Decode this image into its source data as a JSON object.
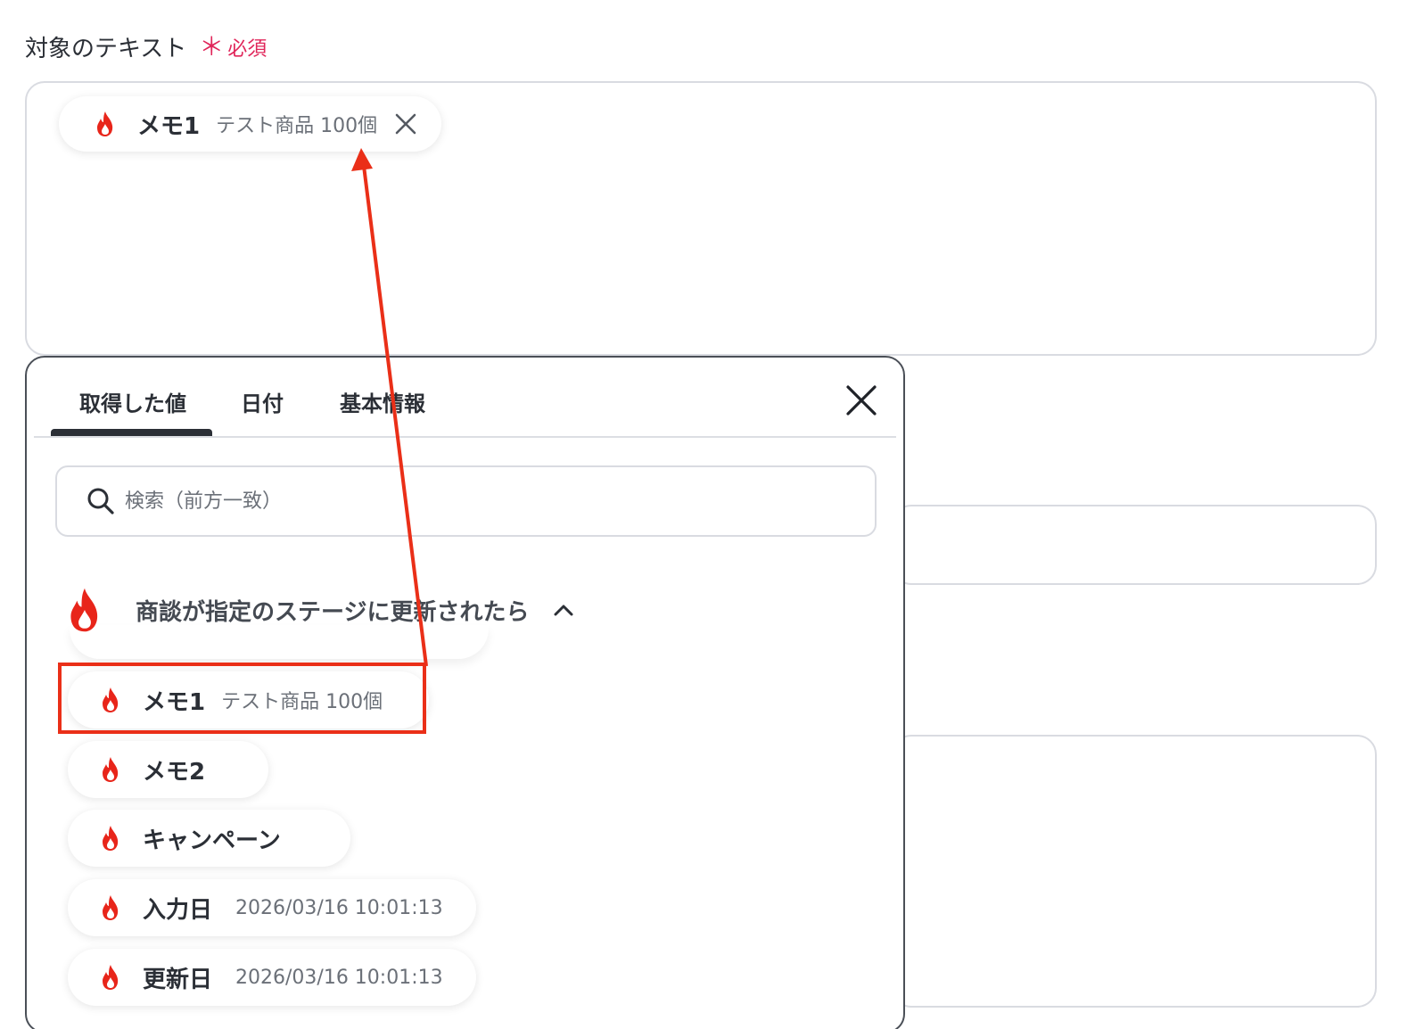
{
  "field": {
    "label": "対象のテキスト",
    "required_mark": "＊",
    "required_text": "必須"
  },
  "selected_chip": {
    "name": "メモ1",
    "value": "テスト商品 100個",
    "icon": "flame-icon"
  },
  "picker": {
    "tabs": [
      {
        "label": "取得した値",
        "active": true
      },
      {
        "label": "日付",
        "active": false
      },
      {
        "label": "基本情報",
        "active": false
      }
    ],
    "search_placeholder": "検索（前方一致）",
    "group": {
      "title": "商談が指定のステージに更新されたら",
      "expanded": true,
      "items": [
        {
          "name": "メモ1",
          "value": "テスト商品 100個",
          "highlighted": true
        },
        {
          "name": "メモ2",
          "value": ""
        },
        {
          "name": "キャンペーン",
          "value": ""
        },
        {
          "name": "入力日",
          "value": "2026/03/16 10:01:13"
        },
        {
          "name": "更新日",
          "value": "2026/03/16 10:01:13"
        }
      ]
    }
  },
  "colors": {
    "required": "#e0265a",
    "annotation": "#ea2f18",
    "flame": "#e8251a",
    "border": "#d9dbe1"
  }
}
